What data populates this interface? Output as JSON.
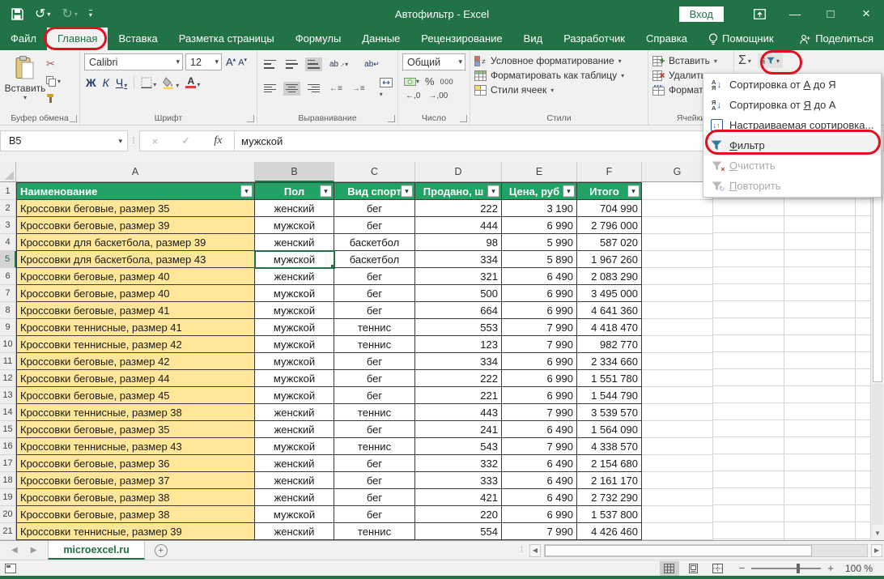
{
  "title_bar": {
    "title": "Автофильтр  -  Excel",
    "sign_in": "Вход"
  },
  "tabs": [
    {
      "label": "Файл",
      "active": false
    },
    {
      "label": "Главная",
      "active": true,
      "annotated": true
    },
    {
      "label": "Вставка",
      "active": false
    },
    {
      "label": "Разметка страницы",
      "active": false
    },
    {
      "label": "Формулы",
      "active": false
    },
    {
      "label": "Данные",
      "active": false
    },
    {
      "label": "Рецензирование",
      "active": false
    },
    {
      "label": "Вид",
      "active": false
    },
    {
      "label": "Разработчик",
      "active": false
    },
    {
      "label": "Справка",
      "active": false
    },
    {
      "label": "Помощник",
      "active": false,
      "icon": "lightbulb-icon"
    }
  ],
  "share_label": "Поделиться",
  "ribbon": {
    "clipboard": {
      "paste": "Вставить",
      "label": "Буфер обмена"
    },
    "font": {
      "family": "Calibri",
      "size": "12",
      "bold": "Ж",
      "italic": "К",
      "underline": "Ч",
      "label": "Шрифт"
    },
    "alignment": {
      "wrap": "ab",
      "label": "Выравнивание"
    },
    "number": {
      "format": "Общий",
      "percent": "%",
      "thousands": "000",
      "label": "Число"
    },
    "styles": {
      "items": [
        "Условное форматирование",
        "Форматировать как таблицу",
        "Стили ячеек"
      ],
      "label": "Стили"
    },
    "cells": {
      "items": [
        "Вставить",
        "Удалить",
        "Формат"
      ],
      "label": "Ячейки"
    },
    "editing": {
      "autosum": "Σ"
    }
  },
  "formula_bar": {
    "name_box": "B5",
    "fx": "fx",
    "value": "мужской"
  },
  "filter_menu": {
    "items": [
      {
        "label": "Сортировка от А до Я",
        "icon": "sort-az-icon",
        "underline": "А",
        "disabled": false,
        "highlighted": false
      },
      {
        "label": "Сортировка от Я до А",
        "icon": "sort-za-icon",
        "underline": "Я",
        "disabled": false,
        "highlighted": false
      },
      {
        "label": "Настраиваемая сортировка...",
        "icon": "custom-sort-icon",
        "underline": "Н",
        "disabled": false,
        "highlighted": false
      },
      {
        "label": "Фильтр",
        "icon": "filter-icon",
        "underline": "Ф",
        "disabled": false,
        "highlighted": true,
        "annotated": true
      },
      {
        "label": "Очистить",
        "icon": "clear-filter-icon",
        "underline": "О",
        "disabled": true,
        "highlighted": false
      },
      {
        "label": "Повторить",
        "icon": "reapply-filter-icon",
        "underline": "П",
        "disabled": true,
        "highlighted": false
      }
    ]
  },
  "sheet": {
    "column_letters": [
      "A",
      "B",
      "C",
      "D",
      "E",
      "F",
      "G"
    ],
    "selected_column": "B",
    "selected_row": 5,
    "table_headers": [
      "Наименование",
      "Пол",
      "Вид спорт",
      "Продано, ш",
      "Цена, руб",
      "Итого"
    ],
    "rows": [
      {
        "n": 2,
        "cells": [
          "Кроссовки беговые, размер 35",
          "женский",
          "бег",
          "222",
          "3 190",
          "704 990"
        ]
      },
      {
        "n": 3,
        "cells": [
          "Кроссовки беговые, размер 39",
          "мужской",
          "бег",
          "444",
          "6 990",
          "2 796 000"
        ]
      },
      {
        "n": 4,
        "cells": [
          "Кроссовки для баскетбола, размер 39",
          "женский",
          "баскетбол",
          "98",
          "5 990",
          "587 020"
        ]
      },
      {
        "n": 5,
        "cells": [
          "Кроссовки для баскетбола, размер 43",
          "мужской",
          "баскетбол",
          "334",
          "5 890",
          "1 967 260"
        ]
      },
      {
        "n": 6,
        "cells": [
          "Кроссовки беговые, размер 40",
          "женский",
          "бег",
          "321",
          "6 490",
          "2 083 290"
        ]
      },
      {
        "n": 7,
        "cells": [
          "Кроссовки беговые, размер 40",
          "мужской",
          "бег",
          "500",
          "6 990",
          "3 495 000"
        ]
      },
      {
        "n": 8,
        "cells": [
          "Кроссовки беговые, размер 41",
          "мужской",
          "бег",
          "664",
          "6 990",
          "4 641 360"
        ]
      },
      {
        "n": 9,
        "cells": [
          "Кроссовки теннисные, размер 41",
          "мужской",
          "теннис",
          "553",
          "7 990",
          "4 418 470"
        ]
      },
      {
        "n": 10,
        "cells": [
          "Кроссовки теннисные, размер 42",
          "мужской",
          "теннис",
          "123",
          "7 990",
          "982 770"
        ]
      },
      {
        "n": 11,
        "cells": [
          "Кроссовки беговые, размер 42",
          "мужской",
          "бег",
          "334",
          "6 990",
          "2 334 660"
        ]
      },
      {
        "n": 12,
        "cells": [
          "Кроссовки беговые, размер 44",
          "мужской",
          "бег",
          "222",
          "6 990",
          "1 551 780"
        ]
      },
      {
        "n": 13,
        "cells": [
          "Кроссовки беговые, размер 45",
          "мужской",
          "бег",
          "221",
          "6 990",
          "1 544 790"
        ]
      },
      {
        "n": 14,
        "cells": [
          "Кроссовки теннисные, размер 38",
          "женский",
          "теннис",
          "443",
          "7 990",
          "3 539 570"
        ]
      },
      {
        "n": 15,
        "cells": [
          "Кроссовки беговые, размер 35",
          "женский",
          "бег",
          "241",
          "6 490",
          "1 564 090"
        ]
      },
      {
        "n": 16,
        "cells": [
          "Кроссовки теннисные, размер 43",
          "мужской",
          "теннис",
          "543",
          "7 990",
          "4 338 570"
        ]
      },
      {
        "n": 17,
        "cells": [
          "Кроссовки беговые, размер 36",
          "женский",
          "бег",
          "332",
          "6 490",
          "2 154 680"
        ]
      },
      {
        "n": 18,
        "cells": [
          "Кроссовки беговые, размер 37",
          "женский",
          "бег",
          "333",
          "6 490",
          "2 161 170"
        ]
      },
      {
        "n": 19,
        "cells": [
          "Кроссовки беговые, размер 38",
          "женский",
          "бег",
          "421",
          "6 490",
          "2 732 290"
        ]
      },
      {
        "n": 20,
        "cells": [
          "Кроссовки беговые, размер 38",
          "мужской",
          "бег",
          "220",
          "6 990",
          "1 537 800"
        ]
      },
      {
        "n": 21,
        "cells": [
          "Кроссовки теннисные, размер 39",
          "женский",
          "теннис",
          "554",
          "7 990",
          "4 426 460"
        ]
      }
    ]
  },
  "sheet_tabs": {
    "active": "microexcel.ru"
  },
  "status_bar": {
    "zoom": "100 %"
  },
  "colors": {
    "brand_green": "#217346",
    "table_header_green": "#21a366",
    "name_column_yellow": "#ffe699",
    "annotation_red": "#e0101e"
  }
}
